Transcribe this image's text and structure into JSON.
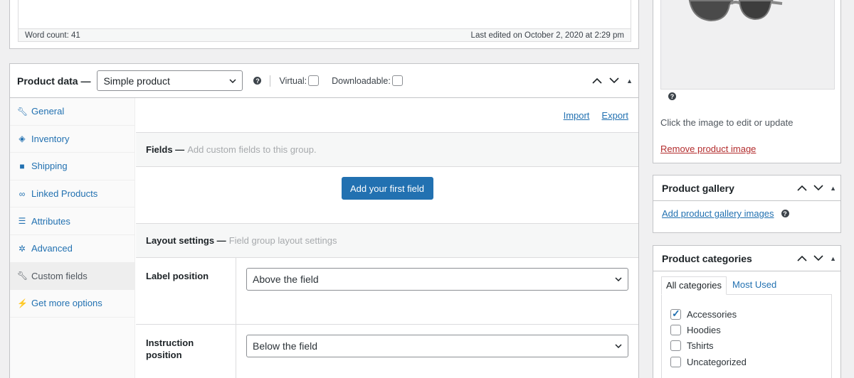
{
  "editor": {
    "word_count": "Word count: 41",
    "last_edited": "Last edited on October 2, 2020 at 2:29 pm"
  },
  "product_data": {
    "title": "Product data —",
    "type_value": "Simple product",
    "virtual_label": "Virtual:",
    "downloadable_label": "Downloadable:",
    "tabs": [
      {
        "label": "General",
        "icon": "wrench-icon"
      },
      {
        "label": "Inventory",
        "icon": "tag-icon"
      },
      {
        "label": "Shipping",
        "icon": "truck-icon"
      },
      {
        "label": "Linked Products",
        "icon": "link-icon"
      },
      {
        "label": "Attributes",
        "icon": "list-icon"
      },
      {
        "label": "Advanced",
        "icon": "gear-icon"
      },
      {
        "label": "Custom fields",
        "icon": "wrench-icon"
      },
      {
        "label": "Get more options",
        "icon": "plugin-icon"
      }
    ],
    "active_tab": "Custom fields",
    "import_label": "Import",
    "export_label": "Export",
    "fields_title": "Fields —",
    "fields_desc": "Add custom fields to this group.",
    "add_field_button": "Add your first field",
    "layout_title": "Layout settings —",
    "layout_desc": "Field group layout settings",
    "label_position_label": "Label position",
    "label_position_value": "Above the field",
    "instruction_position_label": "Instruction position",
    "instruction_position_value": "Below the field"
  },
  "product_image": {
    "note": "Click the image to edit or update",
    "remove_link": "Remove product image"
  },
  "product_gallery": {
    "title": "Product gallery",
    "add_link": "Add product gallery images"
  },
  "product_categories": {
    "title": "Product categories",
    "tab_all": "All categories",
    "tab_used": "Most Used",
    "items": [
      {
        "label": "Accessories",
        "checked": true
      },
      {
        "label": "Hoodies",
        "checked": false
      },
      {
        "label": "Tshirts",
        "checked": false
      },
      {
        "label": "Uncategorized",
        "checked": false
      }
    ]
  },
  "colors": {
    "link": "#2271b1",
    "primary_button": "#2271b1",
    "danger_link": "#b32d2e"
  }
}
